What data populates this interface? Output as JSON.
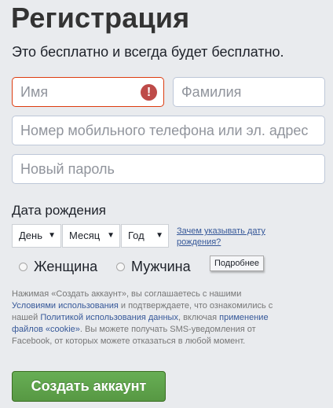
{
  "title": "Регистрация",
  "subtitle": "Это бесплатно и всегда будет бесплатно.",
  "form": {
    "first_name_placeholder": "Имя",
    "last_name_placeholder": "Фамилия",
    "contact_placeholder": "Номер мобильного телефона или эл. адрес",
    "password_placeholder": "Новый пароль",
    "error_icon": "!"
  },
  "dob": {
    "label": "Дата рождения",
    "day": "День",
    "month": "Месяц",
    "year": "Год",
    "why_link": "Зачем указывать дату рождения?"
  },
  "gender": {
    "female": "Женщина",
    "male": "Мужчина",
    "tooltip": "Подробнее"
  },
  "terms": {
    "t1": "Нажимая «Создать аккаунт», вы соглашаетесь с нашими ",
    "l1": "Условиями использования",
    "t2": " и подтверждаете, что ознакомились с нашей ",
    "l2": "Политикой использования данных",
    "t3": ", включая ",
    "l3": "применение файлов «cookie»",
    "t4": ". Вы можете получать SMS-уведомления от Facebook, от которых можете отказаться в любой момент."
  },
  "signup_button": "Создать аккаунт",
  "colors": {
    "button_green": "#67ae55",
    "error_red": "#be4b49",
    "link_blue": "#365899"
  }
}
